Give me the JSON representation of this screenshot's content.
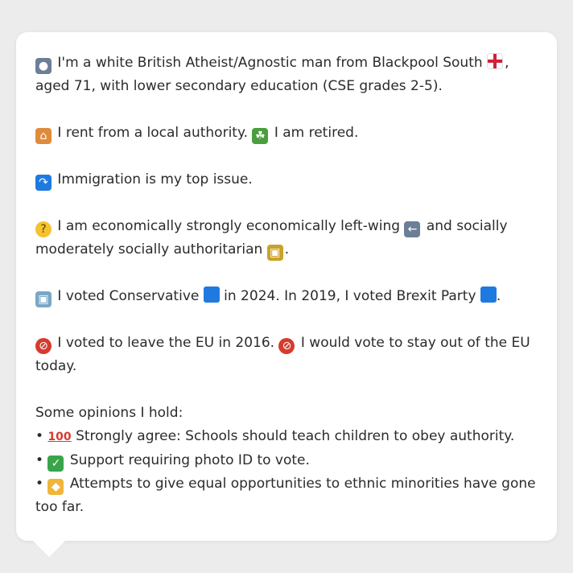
{
  "profile": {
    "line1_a": "I'm a white British Atheist/Agnostic man from Blackpool South",
    "line1_b": ", aged 71, with lower secondary education (CSE grades 2-5).",
    "housing": "I rent from a local authority.",
    "work": "I am retired.",
    "top_issue": "Immigration is my top issue.",
    "econ_a": "I am economically strongly economically left-wing",
    "econ_b": "and socially moderately socially authoritarian",
    "econ_end": ".",
    "vote_a": "I voted Conservative",
    "vote_b": "in 2024. In 2019, I voted Brexit Party",
    "vote_end": ".",
    "eu_a": "I voted to leave the EU in 2016.",
    "eu_b": "I would vote to stay out of the EU today.",
    "opinions_title": "Some opinions I hold:",
    "opinions": [
      "Strongly agree: Schools should teach children to obey authority.",
      "Support requiring photo ID to vote.",
      "Attempts to give equal opportunities to ethnic minorities have gone too far."
    ]
  },
  "icons": {
    "person": "person-icon",
    "england_flag": "england-flag-icon",
    "house": "house-icon",
    "palm": "palm-tree-icon",
    "immigration": "immigration-icon",
    "thinking": "thinking-face-icon",
    "left_arrow": "left-arrow-icon",
    "lock": "lock-icon",
    "ballot": "ballot-box-icon",
    "party_square": "blue-square-icon",
    "no_entry": "prohibited-icon",
    "hundred": "hundred-points-icon",
    "check": "check-mark-icon",
    "handshake": "handshake-icon"
  },
  "colors": {
    "conservative": "#1f7ae0",
    "brexit_party": "#1f7ae0",
    "background": "#ececec",
    "card": "#ffffff"
  }
}
